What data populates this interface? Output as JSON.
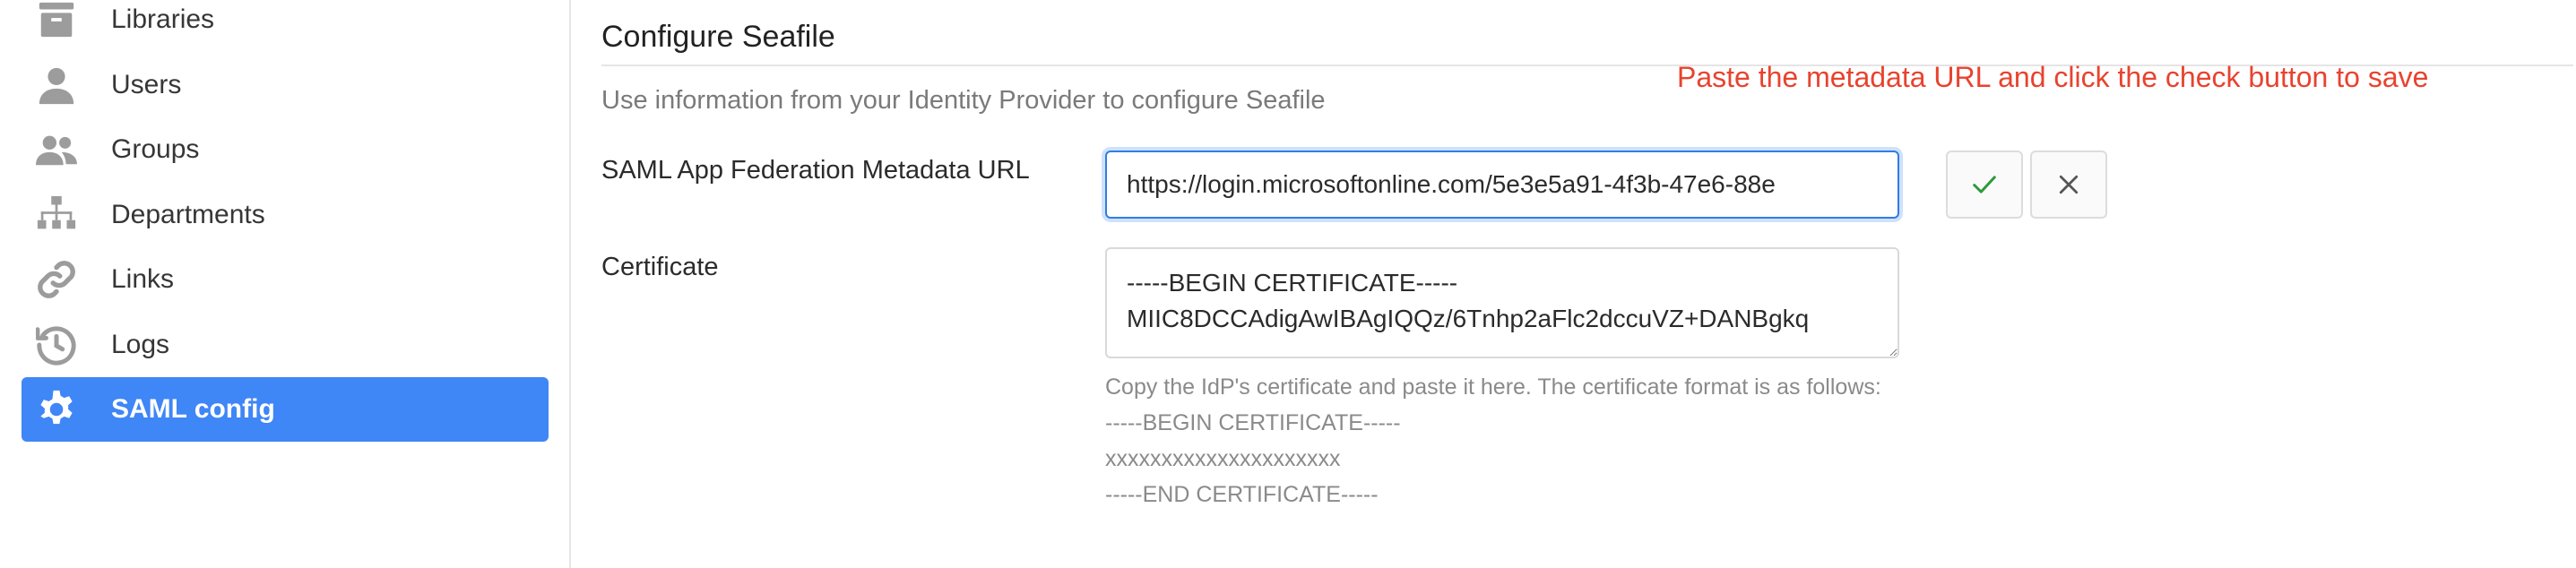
{
  "sidebar": {
    "items": [
      {
        "label": "Libraries",
        "icon": "library-icon"
      },
      {
        "label": "Users",
        "icon": "user-icon"
      },
      {
        "label": "Groups",
        "icon": "groups-icon"
      },
      {
        "label": "Departments",
        "icon": "departments-icon"
      },
      {
        "label": "Links",
        "icon": "link-icon"
      },
      {
        "label": "Logs",
        "icon": "history-icon"
      },
      {
        "label": "SAML config",
        "icon": "gear-icon",
        "active": true
      }
    ],
    "active_color": "#3f86f6"
  },
  "main": {
    "title": "Configure Seafile",
    "intro": "Use information from your Identity Provider to configure Seafile",
    "annotation": "Paste the metadata URL and click the check button to save",
    "annotation_color": "#e8432e",
    "metadata_url": {
      "label": "SAML App Federation Metadata URL",
      "value": "https://login.microsoftonline.com/5e3e5a91-4f3b-47e6-88e"
    },
    "certificate": {
      "label": "Certificate",
      "value": "-----BEGIN CERTIFICATE-----\nMIIC8DCCAdigAwIBAgIQQz/6Tnhp2aFlc2dccuVZ+DANBgkq",
      "help_intro": "Copy the IdP's certificate and paste it here. The certificate format is as follows:",
      "help_begin": "-----BEGIN CERTIFICATE-----",
      "help_body": "xxxxxxxxxxxxxxxxxxxxx",
      "help_end": "-----END CERTIFICATE-----"
    },
    "buttons": {
      "confirm_icon": "check-icon",
      "confirm_color": "#2a9a3a",
      "cancel_icon": "close-icon"
    }
  }
}
